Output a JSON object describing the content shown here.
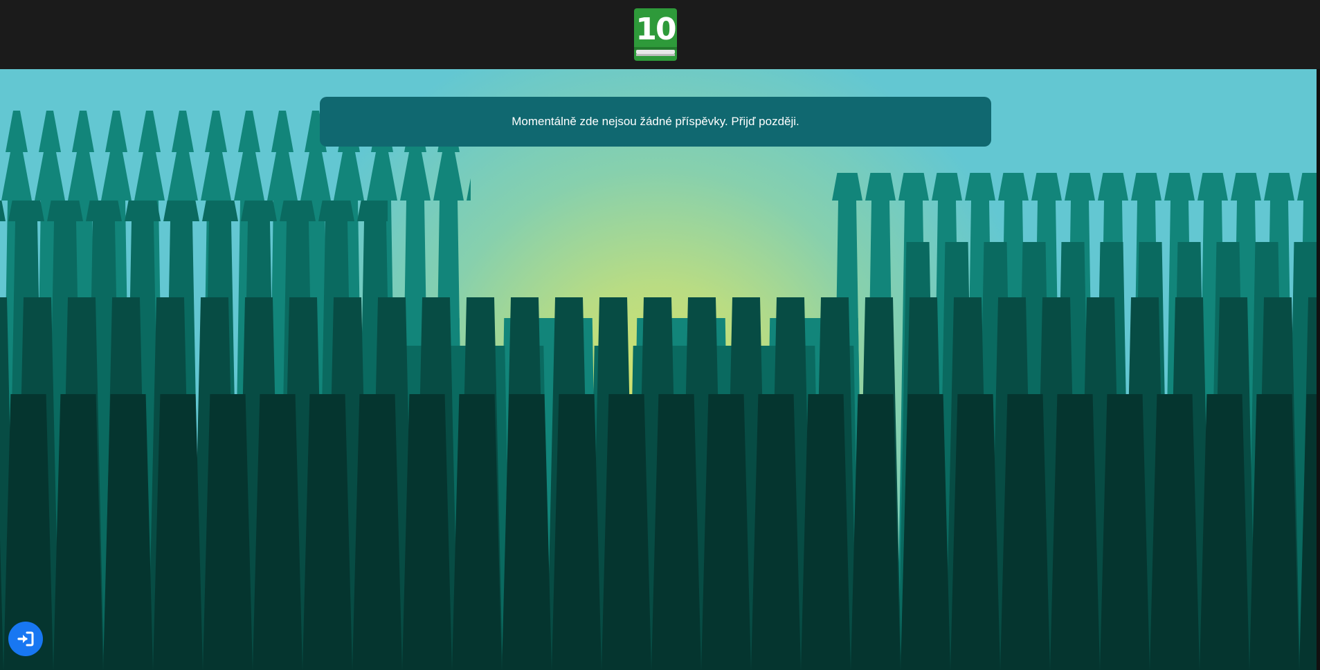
{
  "header": {
    "logo_number": "10",
    "logo_icon": "book-icon",
    "logo_color": "#2e9a3a"
  },
  "main": {
    "notice_text": "Momentálně zde nejsou žádné příspěvky. Přijď později."
  },
  "login_button": {
    "icon": "sign-in-icon",
    "color": "#1877f2"
  },
  "background": {
    "sky_color": "#63c7d2",
    "sun_color": "#d6e36b",
    "forest_colors": [
      "#0f7f73",
      "#0a6259",
      "#084a42",
      "#053630"
    ]
  }
}
